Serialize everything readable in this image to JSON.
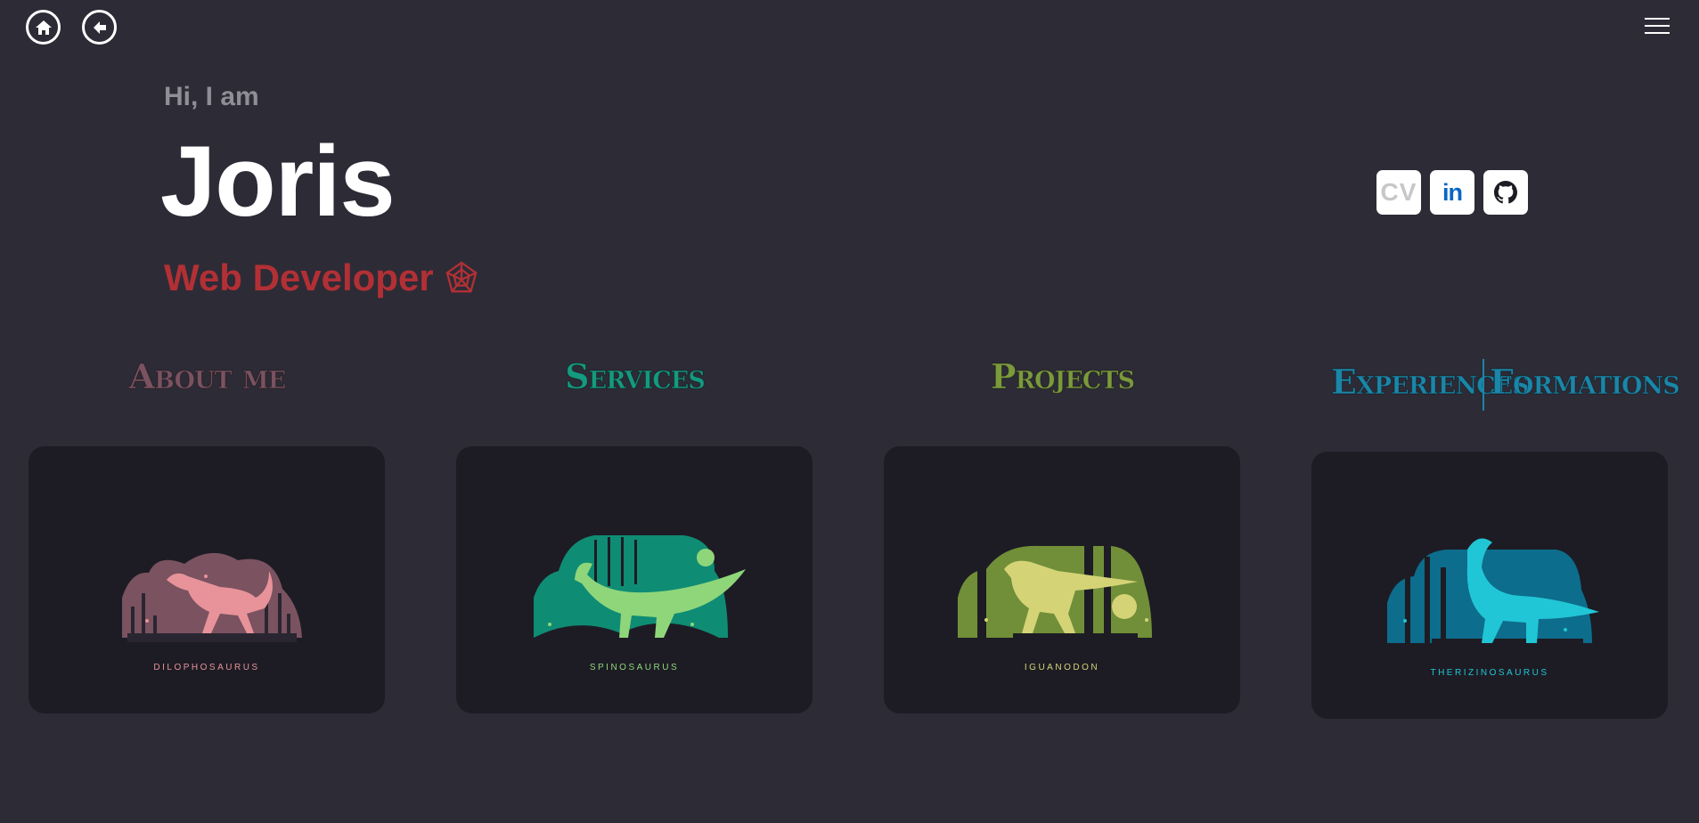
{
  "nav": {
    "home_icon": "home-icon",
    "back_icon": "arrow-left-icon",
    "menu_icon": "hamburger-menu-icon"
  },
  "hero": {
    "greeting": "Hi, I am",
    "name": "Joris",
    "role": "Web Developer",
    "role_icon": "spider-web-icon",
    "role_color": "#b23035"
  },
  "socials": {
    "cv_label": "CV",
    "linkedin_label": "in",
    "github_icon": "github-icon"
  },
  "sections": [
    {
      "title": "About me",
      "color": "#7a5260",
      "dino": "Dilophosaurus",
      "accent": "#e8929a",
      "bg": "#7a5260"
    },
    {
      "title": "Services",
      "color": "#159a80",
      "dino": "Spinosaurus",
      "accent": "#8fd67a",
      "bg": "#0f8c74"
    },
    {
      "title": "Projects",
      "color": "#7b9a3c",
      "dino": "Iguanodon",
      "accent": "#d4d477",
      "bg": "#718f38"
    },
    {
      "title_left": "Experiences",
      "title_right": "Formations",
      "color": "#1b86a8",
      "dino": "Therizinosaurus",
      "accent": "#21c6d6",
      "bg": "#0d6d8c"
    }
  ]
}
